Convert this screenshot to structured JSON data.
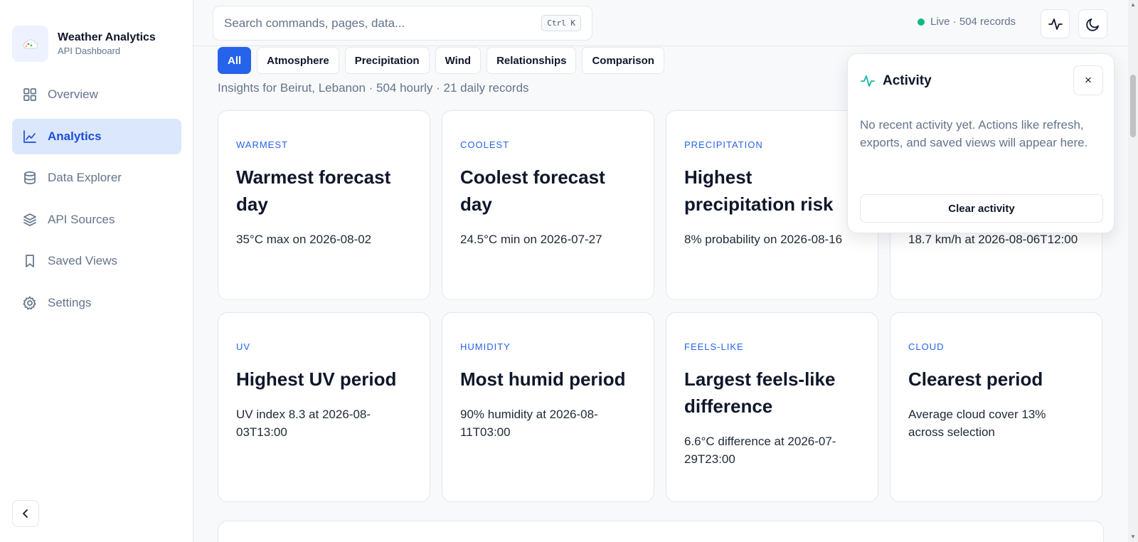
{
  "brand": {
    "title": "Weather Analytics",
    "subtitle": "API Dashboard"
  },
  "nav": [
    {
      "label": "Overview",
      "icon": "grid-icon",
      "active": false
    },
    {
      "label": "Analytics",
      "icon": "chart-line-icon",
      "active": true
    },
    {
      "label": "Data Explorer",
      "icon": "database-icon",
      "active": false
    },
    {
      "label": "API Sources",
      "icon": "layers-icon",
      "active": false
    },
    {
      "label": "Saved Views",
      "icon": "bookmark-icon",
      "active": false
    },
    {
      "label": "Settings",
      "icon": "gear-icon",
      "active": false
    }
  ],
  "search": {
    "placeholder": "Search commands, pages, data...",
    "shortcut": "Ctrl K"
  },
  "status": {
    "live_text": "Live · 504 records",
    "color": "#10b981"
  },
  "filters": [
    "All",
    "Atmosphere",
    "Precipitation",
    "Wind",
    "Relationships",
    "Comparison"
  ],
  "active_filter": "All",
  "insight_line": "Insights for Beirut, Lebanon · 504 hourly · 21 daily records",
  "cards": [
    {
      "category": "WARMEST",
      "title": "Warmest forecast day",
      "desc": "35°C max on 2026-08-02"
    },
    {
      "category": "COOLEST",
      "title": "Coolest forecast day",
      "desc": "24.5°C min on 2026-07-27"
    },
    {
      "category": "PRECIPITATION",
      "title": "Highest precipitation risk",
      "desc": "8% probability on 2026-08-16"
    },
    {
      "category": "",
      "title": "",
      "desc": "18.7 km/h at 2026-08-06T12:00"
    },
    {
      "category": "UV",
      "title": "Highest UV period",
      "desc": "UV index 8.3 at 2026-08-03T13:00"
    },
    {
      "category": "HUMIDITY",
      "title": "Most humid period",
      "desc": "90% humidity at 2026-08-11T03:00"
    },
    {
      "category": "FEELS-LIKE",
      "title": "Largest feels-like difference",
      "desc": "6.6°C difference at 2026-07-29T23:00"
    },
    {
      "category": "CLOUD",
      "title": "Clearest period",
      "desc": "Average cloud cover 13% across selection"
    }
  ],
  "activity": {
    "title": "Activity",
    "close": "×",
    "body": "No recent activity yet. Actions like refresh, exports, and saved views will appear here.",
    "clear_label": "Clear activity"
  },
  "colors": {
    "accent": "#2563eb",
    "active_nav_bg": "#dbe7fd",
    "activity_icon": "#14b8a6"
  }
}
